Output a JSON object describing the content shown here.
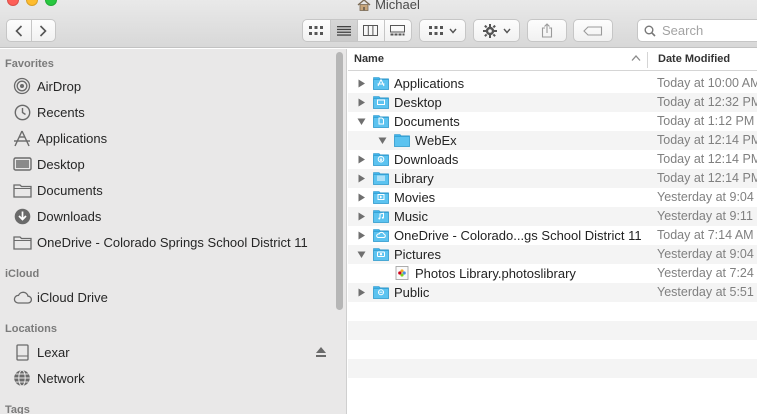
{
  "window": {
    "title": "Michael"
  },
  "search": {
    "placeholder": "Search"
  },
  "sidebar": {
    "favorites_label": "Favorites",
    "favorites": [
      {
        "label": "AirDrop",
        "icon": "airdrop-icon"
      },
      {
        "label": "Recents",
        "icon": "clock-icon"
      },
      {
        "label": "Applications",
        "icon": "applications-icon"
      },
      {
        "label": "Desktop",
        "icon": "desktop-icon"
      },
      {
        "label": "Documents",
        "icon": "folder-icon"
      },
      {
        "label": "Downloads",
        "icon": "download-icon"
      },
      {
        "label": "OneDrive - Colorado Springs School District 11",
        "icon": "folder-icon"
      }
    ],
    "icloud_label": "iCloud",
    "icloud": [
      {
        "label": "iCloud Drive",
        "icon": "cloud-icon"
      }
    ],
    "locations_label": "Locations",
    "locations": [
      {
        "label": "Lexar",
        "icon": "drive-icon"
      },
      {
        "label": "Network",
        "icon": "globe-icon"
      }
    ],
    "tags_label": "Tags"
  },
  "list": {
    "columns": {
      "name": "Name",
      "date": "Date Modified"
    },
    "rows": [
      {
        "name": "Applications",
        "date": "Today at 10:00 AM",
        "level": 0,
        "expanded": false,
        "icon": "applications-folder-icon"
      },
      {
        "name": "Desktop",
        "date": "Today at 12:32 PM",
        "level": 0,
        "expanded": false,
        "icon": "desktop-folder-icon"
      },
      {
        "name": "Documents",
        "date": "Today at 1:12 PM",
        "level": 0,
        "expanded": true,
        "icon": "documents-folder-icon"
      },
      {
        "name": "WebEx",
        "date": "Today at 12:14 PM",
        "level": 1,
        "expanded": true,
        "icon": "folder-icon"
      },
      {
        "name": "Downloads",
        "date": "Today at 12:14 PM",
        "level": 0,
        "expanded": false,
        "icon": "downloads-folder-icon"
      },
      {
        "name": "Library",
        "date": "Today at 12:14 PM",
        "level": 0,
        "expanded": false,
        "icon": "library-folder-icon"
      },
      {
        "name": "Movies",
        "date": "Yesterday at 9:04",
        "level": 0,
        "expanded": false,
        "icon": "movies-folder-icon"
      },
      {
        "name": "Music",
        "date": "Yesterday at 9:11",
        "level": 0,
        "expanded": false,
        "icon": "music-folder-icon"
      },
      {
        "name": "OneDrive - Colorado...gs School District 11",
        "date": "Today at 7:14 AM",
        "level": 0,
        "expanded": false,
        "icon": "onedrive-folder-icon"
      },
      {
        "name": "Pictures",
        "date": "Yesterday at 9:04",
        "level": 0,
        "expanded": true,
        "icon": "pictures-folder-icon"
      },
      {
        "name": "Photos Library.photoslibrary",
        "date": "Yesterday at 7:24",
        "level": 1,
        "expanded": null,
        "icon": "photos-library-icon"
      },
      {
        "name": "Public",
        "date": "Yesterday at 5:51",
        "level": 0,
        "expanded": false,
        "icon": "public-folder-icon"
      }
    ],
    "empty_rows": 5
  },
  "colors": {
    "folder_blue": "#3fb3ea",
    "sidebar_bg": "#e9e8e8",
    "alt_row": "#f4f4f4"
  }
}
